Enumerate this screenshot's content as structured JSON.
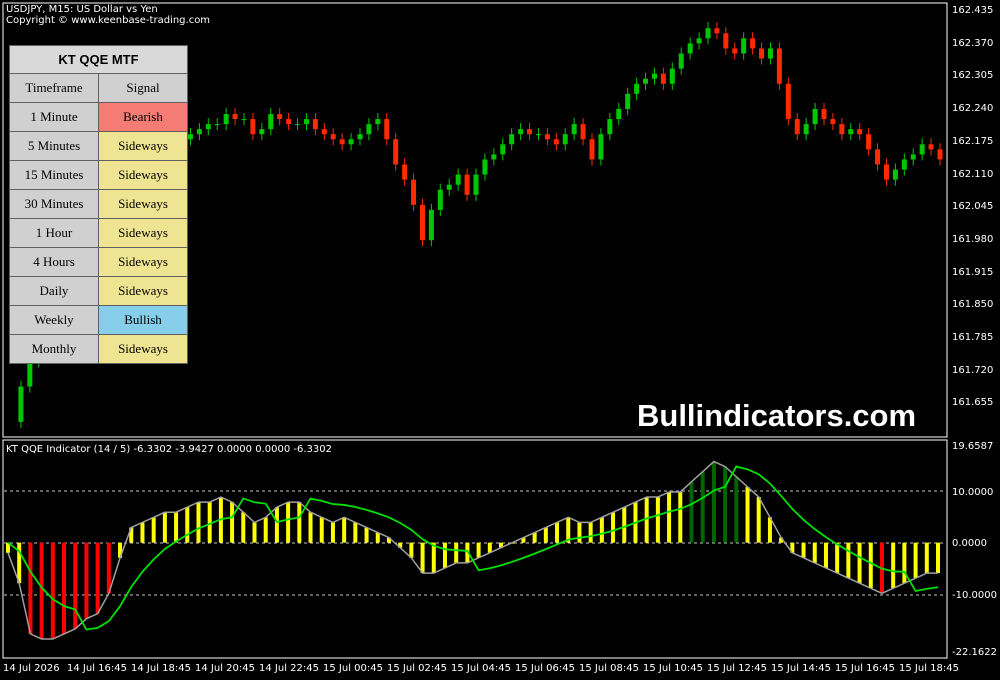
{
  "header": {
    "symbol_line": "USDJPY, M15:  US Dollar vs Yen",
    "copyright": "Copyright © www.keenbase-trading.com"
  },
  "panel": {
    "title": "KT QQE MTF",
    "col_timeframe": "Timeframe",
    "col_signal": "Signal",
    "rows": [
      {
        "timeframe": "1 Minute",
        "signal": "Bearish",
        "state": "bear"
      },
      {
        "timeframe": "5 Minutes",
        "signal": "Sideways",
        "state": "side"
      },
      {
        "timeframe": "15 Minutes",
        "signal": "Sideways",
        "state": "side"
      },
      {
        "timeframe": "30 Minutes",
        "signal": "Sideways",
        "state": "side"
      },
      {
        "timeframe": "1 Hour",
        "signal": "Sideways",
        "state": "side"
      },
      {
        "timeframe": "4 Hours",
        "signal": "Sideways",
        "state": "side"
      },
      {
        "timeframe": "Daily",
        "signal": "Sideways",
        "state": "side"
      },
      {
        "timeframe": "Weekly",
        "signal": "Bullish",
        "state": "bull"
      },
      {
        "timeframe": "Monthly",
        "signal": "Sideways",
        "state": "side"
      }
    ]
  },
  "watermark": "Bullindicators.com",
  "price_axis": [
    "162.435",
    "162.370",
    "162.305",
    "162.240",
    "162.175",
    "162.110",
    "162.045",
    "161.980",
    "161.915",
    "161.850",
    "161.785",
    "161.720",
    "161.655"
  ],
  "indicator": {
    "label": "KT QQE Indicator (14 / 5) -6.3302 -3.9427 0.0000 0.0000 -6.3302",
    "axis": [
      "19.6587",
      "10.0000",
      "0.0000",
      "-10.0000",
      "-22.1622"
    ]
  },
  "time_axis": [
    "14 Jul 2026",
    "14 Jul 16:45",
    "14 Jul 18:45",
    "14 Jul 20:45",
    "14 Jul 22:45",
    "15 Jul 00:45",
    "15 Jul 02:45",
    "15 Jul 04:45",
    "15 Jul 06:45",
    "15 Jul 08:45",
    "15 Jul 10:45",
    "15 Jul 12:45",
    "15 Jul 14:45",
    "15 Jul 16:45",
    "15 Jul 18:45"
  ],
  "colors": {
    "bull_candle": "#00c800",
    "bear_candle": "#ff2a00",
    "qqe_yellow": "#ffff00",
    "qqe_red": "#ff0000",
    "qqe_darkgreen": "#006400",
    "signal_line": "#00e000",
    "rsi_line": "#a0a0a0"
  },
  "chart_data": {
    "type": "candlestick",
    "close_series": [
      161.63,
      161.7,
      161.75,
      161.8,
      161.9,
      162.0,
      162.08,
      162.12,
      162.14,
      162.17,
      162.19,
      162.2,
      162.22,
      162.25,
      162.24,
      162.21,
      162.19,
      162.2,
      162.18,
      162.19,
      162.2,
      162.21,
      162.22,
      162.22,
      162.24,
      162.23,
      162.23,
      162.2,
      162.21,
      162.24,
      162.23,
      162.22,
      162.22,
      162.23,
      162.21,
      162.2,
      162.19,
      162.18,
      162.19,
      162.2,
      162.22,
      162.23,
      162.19,
      162.14,
      162.11,
      162.06,
      161.99,
      162.05,
      162.09,
      162.1,
      162.12,
      162.08,
      162.12,
      162.15,
      162.16,
      162.18,
      162.2,
      162.21,
      162.2,
      162.2,
      162.19,
      162.18,
      162.2,
      162.22,
      162.19,
      162.15,
      162.2,
      162.23,
      162.25,
      162.28,
      162.3,
      162.31,
      162.32,
      162.3,
      162.33,
      162.36,
      162.38,
      162.39,
      162.41,
      162.4,
      162.37,
      162.36,
      162.39,
      162.37,
      162.35,
      162.37,
      162.3,
      162.23,
      162.2,
      162.22,
      162.25,
      162.23,
      162.22,
      162.2,
      162.21,
      162.2,
      162.17,
      162.14,
      162.11,
      162.13,
      162.15,
      162.16,
      162.18,
      162.17,
      162.15
    ],
    "indicator_series": {
      "histogram": [
        -2,
        -8,
        -18,
        -19,
        -19,
        -18,
        -17,
        -15,
        -14,
        -10,
        -3,
        3,
        4,
        5,
        6,
        6,
        7,
        8,
        8,
        9,
        8,
        6,
        4,
        5,
        7,
        8,
        8,
        6,
        5,
        4,
        5,
        4,
        3,
        2,
        1,
        -1,
        -3,
        -6,
        -6,
        -5,
        -4,
        -4,
        -3,
        -2,
        -1,
        0,
        1,
        2,
        3,
        4,
        5,
        4,
        4,
        5,
        6,
        7,
        8,
        9,
        9,
        10,
        10,
        12,
        14,
        16,
        15,
        13,
        11,
        9,
        5,
        1,
        -2,
        -3,
        -4,
        -5,
        -6,
        -7,
        -8,
        -9,
        -10,
        -9,
        -8,
        -7,
        -6,
        -6
      ],
      "ylim": [
        -22.1622,
        19.6587
      ]
    }
  }
}
